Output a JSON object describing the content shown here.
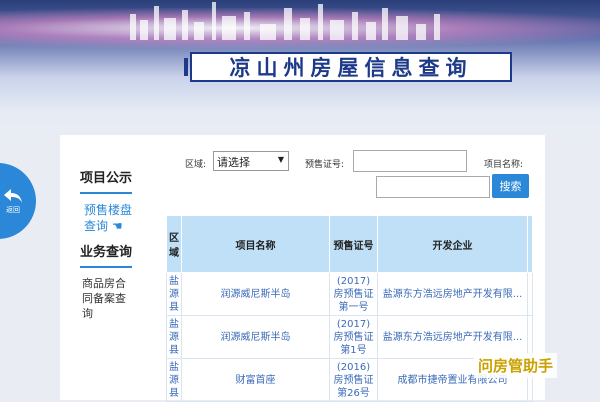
{
  "header": {
    "title": "凉山州房屋信息查询"
  },
  "back_button": {
    "label": "返回"
  },
  "nav": {
    "sections": [
      {
        "heading": "项目公示",
        "items": [
          "预售楼盘查询 ☚"
        ]
      },
      {
        "heading": "业务查询",
        "items": [
          "商品房合同备案查询"
        ]
      }
    ]
  },
  "search": {
    "region_label": "区域:",
    "region_value": "请选择",
    "permit_label": "预售证号:",
    "project_label": "项目名称:",
    "button_label": "搜索"
  },
  "table": {
    "columns": [
      "区域",
      "项目名称",
      "预售证号",
      "开发企业"
    ],
    "rows": [
      [
        "盐源县",
        "润源威尼斯半岛",
        "(2017)房预售证第一号",
        "盐源东方浩远房地产开发有限..."
      ],
      [
        "盐源县",
        "润源威尼斯半岛",
        "(2017)房预售证第1号",
        "盐源东方浩远房地产开发有限..."
      ],
      [
        "盐源县",
        "财富首座",
        "(2016)房预售证第26号",
        "成都市捷帝置业有限公司"
      ]
    ]
  },
  "watermark": "问房管助手",
  "colors": {
    "accent": "#2b88d8",
    "title": "#1d3a8a",
    "header_cell": "#bfe0f7"
  }
}
